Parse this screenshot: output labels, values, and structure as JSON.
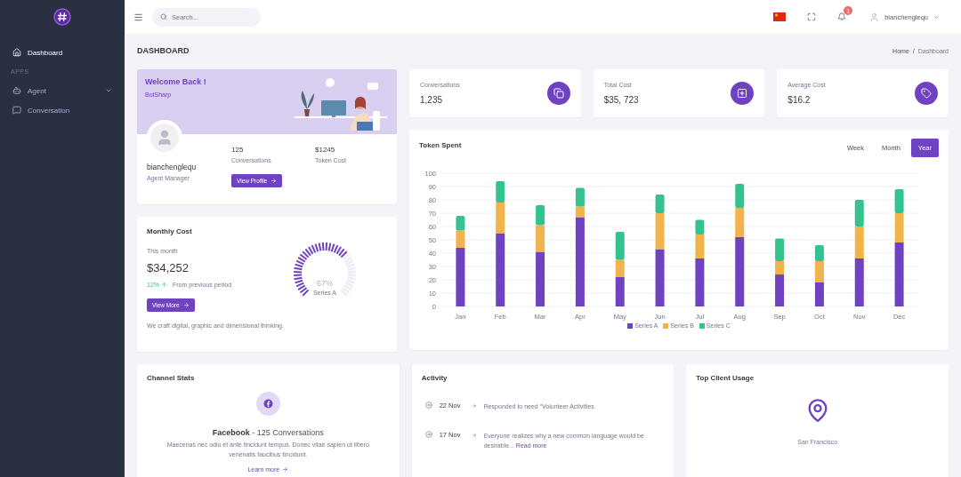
{
  "sidebar": {
    "items": [
      {
        "kind": "link",
        "label": "Dashboard",
        "selected": true
      },
      {
        "kind": "section",
        "label": "APPS"
      },
      {
        "kind": "group",
        "label": "Agent",
        "selected": false
      },
      {
        "kind": "link",
        "label": "Conversation",
        "selected": false
      }
    ]
  },
  "topbar": {
    "search": {
      "placeholder": "Search..."
    },
    "notifications": "1",
    "user": "bianchenglequ"
  },
  "page": {
    "title": "DASHBOARD",
    "breadcrumb": [
      "Home",
      "/",
      "Dashboard"
    ]
  },
  "welcome": {
    "title": "Welcome Back !",
    "subtitle": "BotSharp",
    "name": "bianchenglequ",
    "role": "Agent Manager",
    "stats": [
      {
        "value": "125",
        "label": "Conversations"
      },
      {
        "value": "$1245",
        "label": "Token Cost"
      }
    ],
    "button": "View Profile"
  },
  "stat_cards": [
    {
      "label": "Conversations",
      "value": "1,235"
    },
    {
      "label": "Total Cost",
      "value": "$35, 723"
    },
    {
      "label": "Average Cost",
      "value": "$16.2"
    }
  ],
  "monthly_cost": {
    "title": "Monthly Cost",
    "period": "This month",
    "amount": "$34,252",
    "change": "12%",
    "change_note": "From previous period",
    "button": "View More",
    "gauge": {
      "level": 0.67,
      "reading": "67%",
      "label": "Series A"
    },
    "footer": "We craft digital, graphic and dimensional thinking."
  },
  "token_spent": {
    "title": "Token Spent",
    "tabs": [
      {
        "label": "Week",
        "selected": false
      },
      {
        "label": "Month",
        "selected": false
      },
      {
        "label": "Year",
        "selected": true
      }
    ],
    "chart_data": {
      "type": "bar",
      "stacked": true,
      "grid": true,
      "legend": true,
      "categories": [
        "Jan",
        "Feb",
        "Mar",
        "Apr",
        "May",
        "Jun",
        "Jul",
        "Aug",
        "Sep",
        "Oct",
        "Nov",
        "Dec"
      ],
      "ylim": [
        0,
        100
      ],
      "yticks": [
        0,
        10,
        20,
        30,
        40,
        50,
        60,
        70,
        80,
        90,
        100
      ],
      "series": [
        {
          "name": "Series A",
          "color": "#6f42c1",
          "values": [
            44,
            55,
            41,
            67,
            22,
            43,
            36,
            52,
            24,
            18,
            36,
            48
          ]
        },
        {
          "name": "Series B",
          "color": "#f1b44c",
          "values": [
            13,
            23,
            20,
            8,
            13,
            27,
            18,
            22,
            10,
            16,
            24,
            22
          ]
        },
        {
          "name": "Series C",
          "color": "#34c38f",
          "values": [
            11,
            16,
            15,
            14,
            21,
            14,
            11,
            18,
            17,
            12,
            20,
            18
          ]
        }
      ]
    }
  },
  "channel_stats": {
    "title": "Channel Stats",
    "heading": "**Facebook** - 125 Conversations",
    "text": "Maecenas nec odio et ante tincidunt tempus. Donec vitae sapien ut libero venenatis faucibus tincidunt.",
    "link": "Learn more"
  },
  "activity": {
    "title": "Activity",
    "items": [
      {
        "date": "22 Nov",
        "text": "Responded to need “Volunteer Activities"
      },
      {
        "date": "17 Nov",
        "text": "Everyone realizes why a new common language would be desirable...",
        "link": "Read more"
      }
    ]
  },
  "top_client": {
    "title": "Top Client Usage",
    "location": "San Francisco"
  }
}
